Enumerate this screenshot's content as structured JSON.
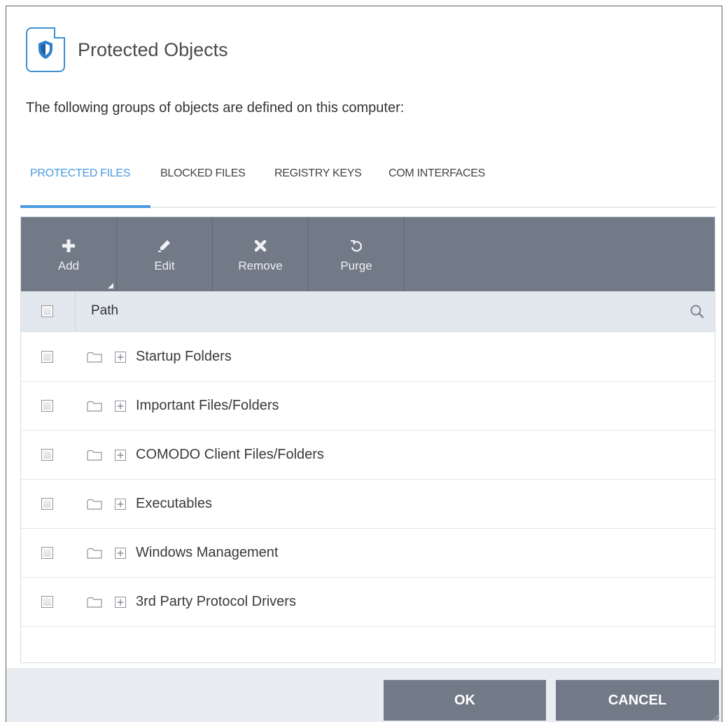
{
  "dialog": {
    "title": "Protected Objects",
    "description": "The following groups of objects are defined on this computer:"
  },
  "tabs": [
    {
      "label": "PROTECTED FILES",
      "active": true
    },
    {
      "label": "BLOCKED FILES",
      "active": false
    },
    {
      "label": "REGISTRY KEYS",
      "active": false
    },
    {
      "label": "COM INTERFACES",
      "active": false
    }
  ],
  "toolbar": {
    "add_label": "Add",
    "edit_label": "Edit",
    "remove_label": "Remove",
    "purge_label": "Purge"
  },
  "grid": {
    "column_header": "Path",
    "rows": [
      {
        "label": "Startup Folders",
        "checked": false
      },
      {
        "label": "Important Files/Folders",
        "checked": false
      },
      {
        "label": "COMODO Client Files/Folders",
        "checked": false
      },
      {
        "label": "Executables",
        "checked": false
      },
      {
        "label": "Windows Management",
        "checked": false
      },
      {
        "label": "3rd Party Protocol Drivers",
        "checked": false
      }
    ]
  },
  "footer": {
    "ok_label": "OK",
    "cancel_label": "CANCEL"
  },
  "colors": {
    "accent": "#4a9be0",
    "toolbar_bg": "#727a87",
    "header_bg": "#e3e8ef",
    "footer_bg": "#e9ecf0"
  },
  "icons": {
    "header": "shield-document-icon",
    "add": "plus-icon",
    "edit": "pencil-icon",
    "remove": "x-icon",
    "purge": "refresh-icon",
    "search": "search-icon",
    "row_folder": "folder-icon",
    "row_expand": "expand-plus-icon"
  }
}
